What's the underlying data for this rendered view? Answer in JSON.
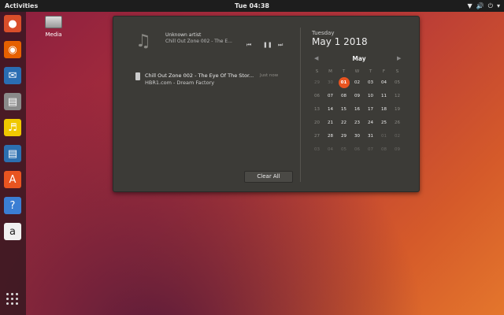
{
  "topbar": {
    "activities": "Activities",
    "clock": "Tue 04:38",
    "tray": [
      "network-icon",
      "volume-icon",
      "power-icon"
    ]
  },
  "dock": {
    "apps": [
      {
        "name": "ubuntu-software-updater",
        "color": "#d94e2a"
      },
      {
        "name": "firefox",
        "color": "#e66000"
      },
      {
        "name": "thunderbird",
        "color": "#2a6db3"
      },
      {
        "name": "files",
        "color": "#8a8a8a"
      },
      {
        "name": "rhythmbox",
        "color": "#f0c800"
      },
      {
        "name": "libreoffice-writer",
        "color": "#2c6fb0"
      },
      {
        "name": "ubuntu-software",
        "color": "#e95420"
      },
      {
        "name": "help",
        "color": "#3b7ed3"
      },
      {
        "name": "amazon",
        "color": "#f0f0f0"
      }
    ]
  },
  "desktop": {
    "media_label": "Media"
  },
  "media": {
    "artist": "Unknown artist",
    "track": "Chill Out Zone 002 - The E..."
  },
  "notification": {
    "title": "Chill Out Zone 002 - The Eye Of The Stor...",
    "subtitle": "HBR1.com - Dream Factory",
    "time": "Just now"
  },
  "clear_all": "Clear All",
  "calendar": {
    "weekday": "Tuesday",
    "date": "May 1 2018",
    "month": "May",
    "headers": [
      "S",
      "M",
      "T",
      "W",
      "T",
      "F",
      "S"
    ],
    "weeks": [
      [
        {
          "d": "29",
          "o": true
        },
        {
          "d": "30",
          "o": true
        },
        {
          "d": "01",
          "today": true
        },
        {
          "d": "02"
        },
        {
          "d": "03"
        },
        {
          "d": "04"
        },
        {
          "d": "05",
          "w": true
        }
      ],
      [
        {
          "d": "06",
          "w": true
        },
        {
          "d": "07"
        },
        {
          "d": "08"
        },
        {
          "d": "09"
        },
        {
          "d": "10"
        },
        {
          "d": "11"
        },
        {
          "d": "12",
          "w": true
        }
      ],
      [
        {
          "d": "13",
          "w": true
        },
        {
          "d": "14"
        },
        {
          "d": "15"
        },
        {
          "d": "16"
        },
        {
          "d": "17"
        },
        {
          "d": "18"
        },
        {
          "d": "19",
          "w": true
        }
      ],
      [
        {
          "d": "20",
          "w": true
        },
        {
          "d": "21"
        },
        {
          "d": "22"
        },
        {
          "d": "23"
        },
        {
          "d": "24"
        },
        {
          "d": "25"
        },
        {
          "d": "26",
          "w": true
        }
      ],
      [
        {
          "d": "27",
          "w": true
        },
        {
          "d": "28"
        },
        {
          "d": "29"
        },
        {
          "d": "30"
        },
        {
          "d": "31"
        },
        {
          "d": "01",
          "o": true
        },
        {
          "d": "02",
          "o": true
        }
      ],
      [
        {
          "d": "03",
          "o": true
        },
        {
          "d": "04",
          "o": true
        },
        {
          "d": "05",
          "o": true
        },
        {
          "d": "06",
          "o": true
        },
        {
          "d": "07",
          "o": true
        },
        {
          "d": "08",
          "o": true
        },
        {
          "d": "09",
          "o": true
        }
      ]
    ]
  }
}
